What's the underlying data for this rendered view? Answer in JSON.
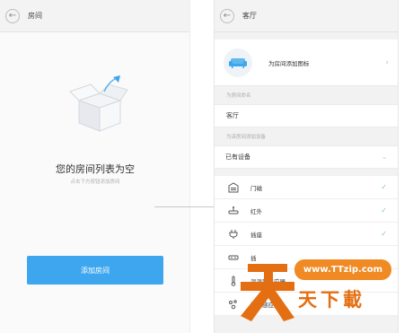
{
  "left": {
    "header_title": "房间",
    "empty_title": "您的房间列表为空",
    "empty_hint": "点击下方按钮添加房间",
    "add_button": "添加房间"
  },
  "right": {
    "header_title": "客厅",
    "add_icon_label": "为房间添加图标",
    "name_section": "为房间命名",
    "name_value": "客厅",
    "device_section": "为该房间添加设备",
    "existing_devices_label": "已有设备",
    "devices": [
      {
        "name": "门磁",
        "checked": true,
        "icon": "door-sensor-icon"
      },
      {
        "name": "红外",
        "checked": true,
        "icon": "infrared-icon"
      },
      {
        "name": "插座",
        "checked": true,
        "icon": "plug-icon"
      },
      {
        "name": "插",
        "checked": false,
        "icon": "strip-icon"
      },
      {
        "name": "温湿度感应器",
        "checked": false,
        "icon": "thermometer-icon"
      },
      {
        "name": "漏水感应器",
        "checked": false,
        "icon": "water-leak-icon"
      }
    ]
  },
  "watermark": {
    "url": "www.TTzip.com",
    "text": "天下載"
  },
  "colors": {
    "accent": "#3ea6ee",
    "check": "#7bc9b0",
    "watermark": "#e46f12"
  }
}
